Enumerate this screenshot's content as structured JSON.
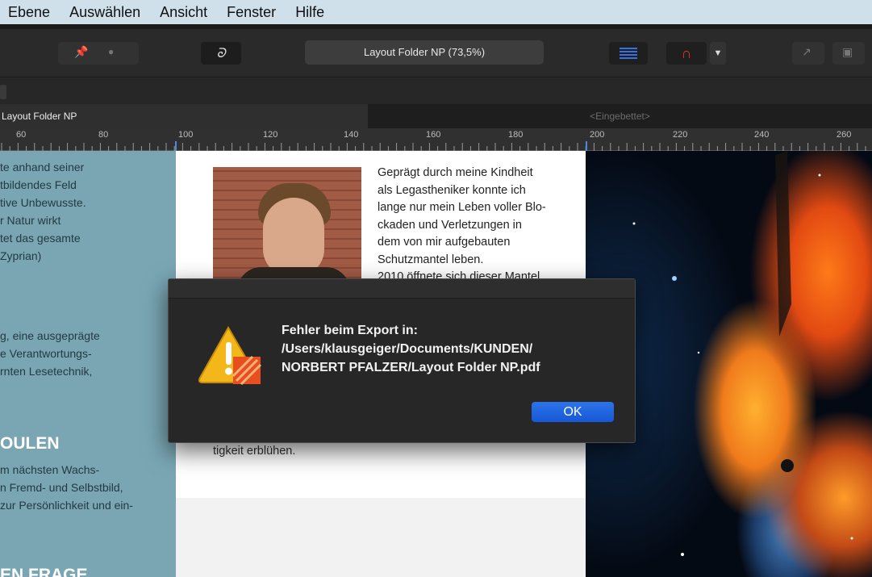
{
  "menu": [
    "Ebene",
    "Auswählen",
    "Ansicht",
    "Fenster",
    "Hilfe"
  ],
  "toolbar": {
    "document_title": "Layout Folder NP (73,5%)",
    "icons": [
      "pin-icon",
      "dot-icon",
      "cursive-tool-icon",
      "lines-icon",
      "magnet-icon",
      "dropdown-icon",
      "export-icon",
      "frame-icon"
    ],
    "cursive_label": "ᘐ"
  },
  "tabs": {
    "active": "Layout Folder NP",
    "inactive": "<Eingebettet>"
  },
  "ruler": {
    "labels": [
      "60",
      "80",
      "100",
      "120",
      "140",
      "160",
      "180",
      "200",
      "220",
      "240",
      "260"
    ]
  },
  "left_panel": {
    "text_block_1": [
      "te anhand seiner",
      "tbildendes Feld",
      "tive Unbewusste.",
      "r Natur wirkt",
      "tet das gesamte",
      "Zyprian)"
    ],
    "text_block_2": [
      "g, eine ausgeprägte",
      "e Verantwortungs-",
      "rnten Lesetechnik,"
    ],
    "heading_1": "OULEN",
    "text_block_3": [
      "m nächsten Wachs-",
      "n Fremd- und Selbstbild,",
      "zur Persönlichkeit und ein-"
    ],
    "heading_2": "EN FRAGE"
  },
  "middle_panel": {
    "lines": [
      "Geprägt durch meine Kindheit",
      "als Legastheniker konnte ich",
      "lange nur mein Leben voller Blo-",
      "ckaden und Verletzungen in",
      "dem von mir aufgebauten",
      "Schutzmantel leben.",
      "2010 öffnete sich dieser Mantel"
    ],
    "bottom_line": "tigkeit erblühen."
  },
  "dialog": {
    "line1": "Fehler beim Export in:",
    "line2": "/Users/klausgeiger/Documents/KUNDEN/",
    "line3": "NORBERT PFALZER/Layout Folder NP.pdf",
    "ok_label": "OK",
    "accent": "#1f66e0"
  }
}
